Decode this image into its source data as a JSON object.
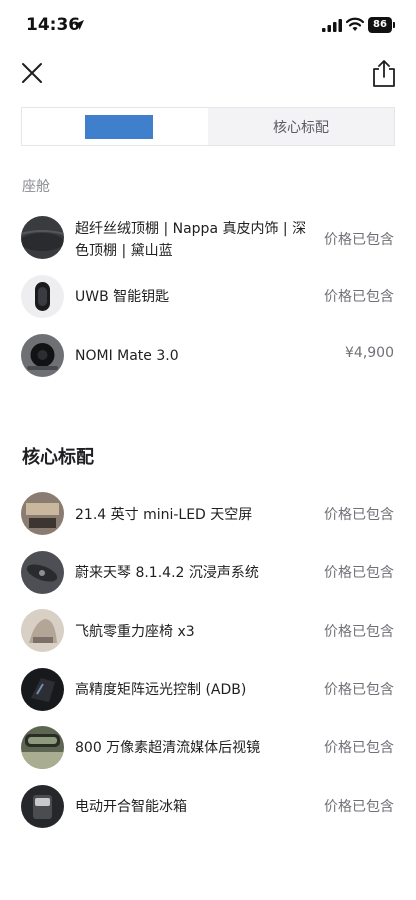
{
  "status_bar": {
    "time": "14:36",
    "battery": "86"
  },
  "tabs": [
    {
      "label": "",
      "active": true
    },
    {
      "label": "核心标配",
      "active": false
    }
  ],
  "cabin": {
    "label": "座舱",
    "items": [
      {
        "title": "超纤丝绒顶棚 | Nappa 真皮内饰 | 深色顶棚 | 黛山蓝",
        "price": "价格已包含"
      },
      {
        "title": "UWB 智能钥匙",
        "price": "价格已包含"
      },
      {
        "title": "NOMI Mate 3.0",
        "price": "¥4,900"
      }
    ]
  },
  "core": {
    "heading": "核心标配",
    "items": [
      {
        "title": "21.4 英寸 mini-LED 天空屏",
        "price": "价格已包含"
      },
      {
        "title": "蔚来天琴 8.1.4.2 沉浸声系统",
        "price": "价格已包含"
      },
      {
        "title": "飞航零重力座椅 x3",
        "price": "价格已包含"
      },
      {
        "title": "高精度矩阵远光控制 (ADB)",
        "price": "价格已包含"
      },
      {
        "title": "800 万像素超清流媒体后视镜",
        "price": "价格已包含"
      },
      {
        "title": "电动开合智能冰箱",
        "price": "价格已包含"
      }
    ]
  }
}
